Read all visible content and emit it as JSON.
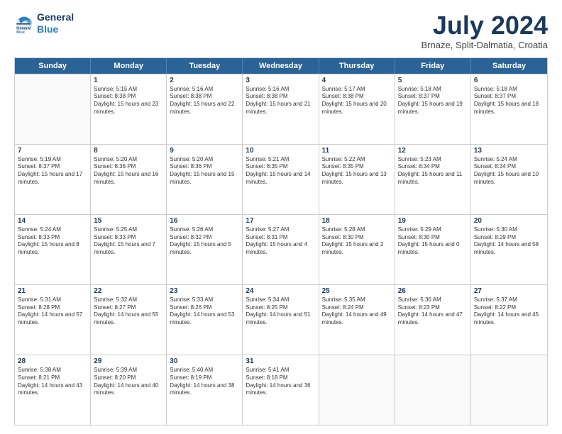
{
  "header": {
    "logo_line1": "General",
    "logo_line2": "Blue",
    "month_title": "July 2024",
    "subtitle": "Brnaze, Split-Dalmatia, Croatia"
  },
  "weekdays": [
    "Sunday",
    "Monday",
    "Tuesday",
    "Wednesday",
    "Thursday",
    "Friday",
    "Saturday"
  ],
  "rows": [
    [
      {
        "day": "",
        "sunrise": "",
        "sunset": "",
        "daylight": ""
      },
      {
        "day": "1",
        "sunrise": "Sunrise: 5:15 AM",
        "sunset": "Sunset: 8:38 PM",
        "daylight": "Daylight: 15 hours and 23 minutes."
      },
      {
        "day": "2",
        "sunrise": "Sunrise: 5:16 AM",
        "sunset": "Sunset: 8:38 PM",
        "daylight": "Daylight: 15 hours and 22 minutes."
      },
      {
        "day": "3",
        "sunrise": "Sunrise: 5:16 AM",
        "sunset": "Sunset: 8:38 PM",
        "daylight": "Daylight: 15 hours and 21 minutes."
      },
      {
        "day": "4",
        "sunrise": "Sunrise: 5:17 AM",
        "sunset": "Sunset: 8:38 PM",
        "daylight": "Daylight: 15 hours and 20 minutes."
      },
      {
        "day": "5",
        "sunrise": "Sunrise: 5:18 AM",
        "sunset": "Sunset: 8:37 PM",
        "daylight": "Daylight: 15 hours and 19 minutes."
      },
      {
        "day": "6",
        "sunrise": "Sunrise: 5:18 AM",
        "sunset": "Sunset: 8:37 PM",
        "daylight": "Daylight: 15 hours and 18 minutes."
      }
    ],
    [
      {
        "day": "7",
        "sunrise": "Sunrise: 5:19 AM",
        "sunset": "Sunset: 8:37 PM",
        "daylight": "Daylight: 15 hours and 17 minutes."
      },
      {
        "day": "8",
        "sunrise": "Sunrise: 5:20 AM",
        "sunset": "Sunset: 8:36 PM",
        "daylight": "Daylight: 15 hours and 16 minutes."
      },
      {
        "day": "9",
        "sunrise": "Sunrise: 5:20 AM",
        "sunset": "Sunset: 8:36 PM",
        "daylight": "Daylight: 15 hours and 15 minutes."
      },
      {
        "day": "10",
        "sunrise": "Sunrise: 5:21 AM",
        "sunset": "Sunset: 8:35 PM",
        "daylight": "Daylight: 15 hours and 14 minutes."
      },
      {
        "day": "11",
        "sunrise": "Sunrise: 5:22 AM",
        "sunset": "Sunset: 8:35 PM",
        "daylight": "Daylight: 15 hours and 13 minutes."
      },
      {
        "day": "12",
        "sunrise": "Sunrise: 5:23 AM",
        "sunset": "Sunset: 8:34 PM",
        "daylight": "Daylight: 15 hours and 11 minutes."
      },
      {
        "day": "13",
        "sunrise": "Sunrise: 5:24 AM",
        "sunset": "Sunset: 8:34 PM",
        "daylight": "Daylight: 15 hours and 10 minutes."
      }
    ],
    [
      {
        "day": "14",
        "sunrise": "Sunrise: 5:24 AM",
        "sunset": "Sunset: 8:33 PM",
        "daylight": "Daylight: 15 hours and 8 minutes."
      },
      {
        "day": "15",
        "sunrise": "Sunrise: 5:25 AM",
        "sunset": "Sunset: 8:33 PM",
        "daylight": "Daylight: 15 hours and 7 minutes."
      },
      {
        "day": "16",
        "sunrise": "Sunrise: 5:26 AM",
        "sunset": "Sunset: 8:32 PM",
        "daylight": "Daylight: 15 hours and 5 minutes."
      },
      {
        "day": "17",
        "sunrise": "Sunrise: 5:27 AM",
        "sunset": "Sunset: 8:31 PM",
        "daylight": "Daylight: 15 hours and 4 minutes."
      },
      {
        "day": "18",
        "sunrise": "Sunrise: 5:28 AM",
        "sunset": "Sunset: 8:30 PM",
        "daylight": "Daylight: 15 hours and 2 minutes."
      },
      {
        "day": "19",
        "sunrise": "Sunrise: 5:29 AM",
        "sunset": "Sunset: 8:30 PM",
        "daylight": "Daylight: 15 hours and 0 minutes."
      },
      {
        "day": "20",
        "sunrise": "Sunrise: 5:30 AM",
        "sunset": "Sunset: 8:29 PM",
        "daylight": "Daylight: 14 hours and 58 minutes."
      }
    ],
    [
      {
        "day": "21",
        "sunrise": "Sunrise: 5:31 AM",
        "sunset": "Sunset: 8:28 PM",
        "daylight": "Daylight: 14 hours and 57 minutes."
      },
      {
        "day": "22",
        "sunrise": "Sunrise: 5:32 AM",
        "sunset": "Sunset: 8:27 PM",
        "daylight": "Daylight: 14 hours and 55 minutes."
      },
      {
        "day": "23",
        "sunrise": "Sunrise: 5:33 AM",
        "sunset": "Sunset: 8:26 PM",
        "daylight": "Daylight: 14 hours and 53 minutes."
      },
      {
        "day": "24",
        "sunrise": "Sunrise: 5:34 AM",
        "sunset": "Sunset: 8:25 PM",
        "daylight": "Daylight: 14 hours and 51 minutes."
      },
      {
        "day": "25",
        "sunrise": "Sunrise: 5:35 AM",
        "sunset": "Sunset: 8:24 PM",
        "daylight": "Daylight: 14 hours and 49 minutes."
      },
      {
        "day": "26",
        "sunrise": "Sunrise: 5:36 AM",
        "sunset": "Sunset: 8:23 PM",
        "daylight": "Daylight: 14 hours and 47 minutes."
      },
      {
        "day": "27",
        "sunrise": "Sunrise: 5:37 AM",
        "sunset": "Sunset: 8:22 PM",
        "daylight": "Daylight: 14 hours and 45 minutes."
      }
    ],
    [
      {
        "day": "28",
        "sunrise": "Sunrise: 5:38 AM",
        "sunset": "Sunset: 8:21 PM",
        "daylight": "Daylight: 14 hours and 43 minutes."
      },
      {
        "day": "29",
        "sunrise": "Sunrise: 5:39 AM",
        "sunset": "Sunset: 8:20 PM",
        "daylight": "Daylight: 14 hours and 40 minutes."
      },
      {
        "day": "30",
        "sunrise": "Sunrise: 5:40 AM",
        "sunset": "Sunset: 8:19 PM",
        "daylight": "Daylight: 14 hours and 38 minutes."
      },
      {
        "day": "31",
        "sunrise": "Sunrise: 5:41 AM",
        "sunset": "Sunset: 8:18 PM",
        "daylight": "Daylight: 14 hours and 36 minutes."
      },
      {
        "day": "",
        "sunrise": "",
        "sunset": "",
        "daylight": ""
      },
      {
        "day": "",
        "sunrise": "",
        "sunset": "",
        "daylight": ""
      },
      {
        "day": "",
        "sunrise": "",
        "sunset": "",
        "daylight": ""
      }
    ]
  ]
}
